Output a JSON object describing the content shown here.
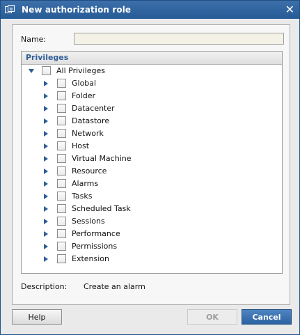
{
  "window": {
    "title": "New authorization role",
    "close_icon": "close-icon"
  },
  "form": {
    "name_label": "Name:",
    "name_value": "",
    "name_placeholder": ""
  },
  "privileges": {
    "header": "Privileges",
    "root": {
      "label": "All Privileges",
      "expanded": true,
      "checked": false
    },
    "items": [
      {
        "label": "Global",
        "expanded": false,
        "checked": false
      },
      {
        "label": "Folder",
        "expanded": false,
        "checked": false
      },
      {
        "label": "Datacenter",
        "expanded": false,
        "checked": false
      },
      {
        "label": "Datastore",
        "expanded": false,
        "checked": false
      },
      {
        "label": "Network",
        "expanded": false,
        "checked": false
      },
      {
        "label": "Host",
        "expanded": false,
        "checked": false
      },
      {
        "label": "Virtual Machine",
        "expanded": false,
        "checked": false
      },
      {
        "label": "Resource",
        "expanded": false,
        "checked": false
      },
      {
        "label": "Alarms",
        "expanded": false,
        "checked": false
      },
      {
        "label": "Tasks",
        "expanded": false,
        "checked": false
      },
      {
        "label": "Scheduled Task",
        "expanded": false,
        "checked": false
      },
      {
        "label": "Sessions",
        "expanded": false,
        "checked": false
      },
      {
        "label": "Performance",
        "expanded": false,
        "checked": false
      },
      {
        "label": "Permissions",
        "expanded": false,
        "checked": false
      },
      {
        "label": "Extension",
        "expanded": false,
        "checked": false
      }
    ]
  },
  "description": {
    "label": "Description:",
    "value": "Create an alarm"
  },
  "buttons": {
    "help": "Help",
    "ok": "OK",
    "cancel": "Cancel",
    "ok_enabled": false
  },
  "colors": {
    "titlebar": "#255b96",
    "accent": "#2f5f98",
    "cancel": "#2c62a2"
  }
}
